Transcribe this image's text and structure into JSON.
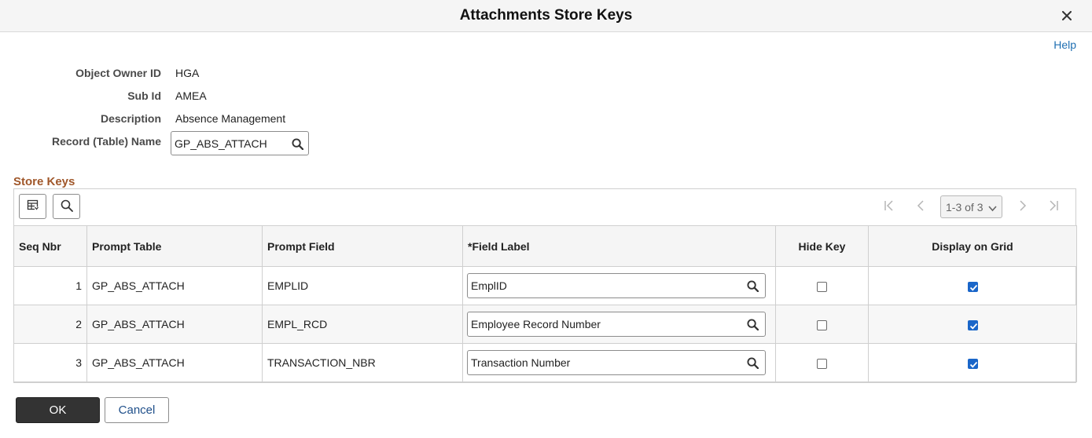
{
  "dialog": {
    "title": "Attachments Store Keys",
    "help_label": "Help",
    "close_icon": "close-icon"
  },
  "form": {
    "object_owner_label": "Object Owner ID",
    "object_owner_value": "HGA",
    "sub_id_label": "Sub Id",
    "sub_id_value": "AMEA",
    "description_label": "Description",
    "description_value": "Absence Management",
    "record_name_label": "Record (Table) Name",
    "record_name_value": "GP_ABS_ATTACH"
  },
  "store_keys": {
    "section_title": "Store Keys",
    "pager": {
      "range_label": "1-3 of 3"
    },
    "columns": [
      "Seq Nbr",
      "Prompt Table",
      "Prompt Field",
      "*Field Label",
      "Hide Key",
      "Display on Grid"
    ],
    "rows": [
      {
        "seq": "1",
        "prompt_table": "GP_ABS_ATTACH",
        "prompt_field": "EMPLID",
        "field_label": "EmplID",
        "hide_key": false,
        "display_on_grid": true
      },
      {
        "seq": "2",
        "prompt_table": "GP_ABS_ATTACH",
        "prompt_field": "EMPL_RCD",
        "field_label": "Employee Record Number",
        "hide_key": false,
        "display_on_grid": true
      },
      {
        "seq": "3",
        "prompt_table": "GP_ABS_ATTACH",
        "prompt_field": "TRANSACTION_NBR",
        "field_label": "Transaction Number",
        "hide_key": false,
        "display_on_grid": true
      }
    ]
  },
  "footer": {
    "ok_label": "OK",
    "cancel_label": "Cancel"
  },
  "colors": {
    "section_title": "#a0572a",
    "link": "#1f6fb2",
    "checkbox_checked": "#1a66c9",
    "ok_button_bg": "#333333"
  }
}
